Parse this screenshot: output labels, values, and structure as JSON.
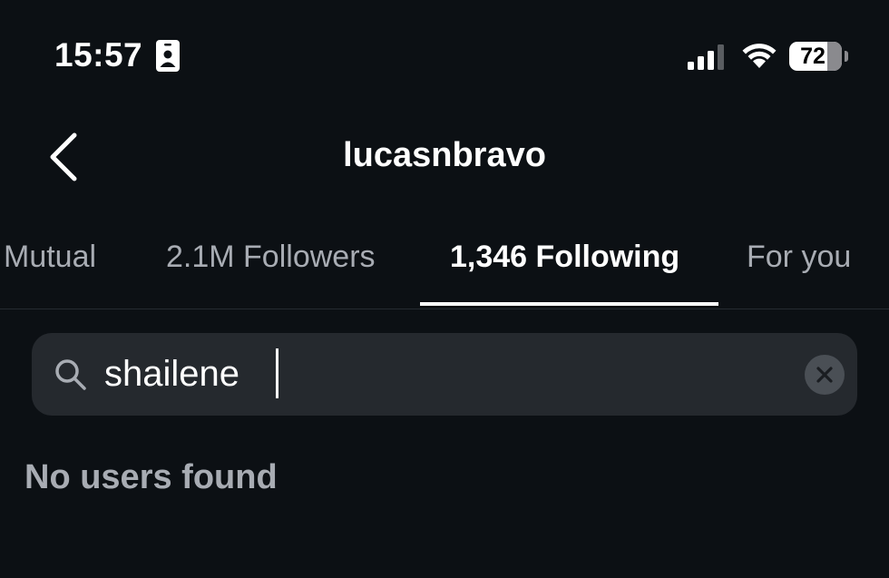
{
  "status_bar": {
    "time": "15:57",
    "battery_level": 72,
    "battery_text": "72",
    "icons": [
      "id-card-icon",
      "cellular-signal-icon",
      "wifi-icon",
      "battery-icon"
    ]
  },
  "header": {
    "title": "lucasnbravo",
    "back_icon": "chevron-left-icon"
  },
  "tabs": [
    {
      "label": "Mutual",
      "active": false
    },
    {
      "label": "2.1M Followers",
      "active": false
    },
    {
      "label": "1,346 Following",
      "active": true
    },
    {
      "label": "For you",
      "active": false
    }
  ],
  "search": {
    "value": "shailene",
    "icon": "search-icon",
    "clear_icon": "clear-icon"
  },
  "results": {
    "empty_message": "No users found"
  },
  "colors": {
    "background": "#0c1014",
    "search_background": "#25292e",
    "active_text": "#ffffff",
    "muted_text": "#a8acb3"
  }
}
